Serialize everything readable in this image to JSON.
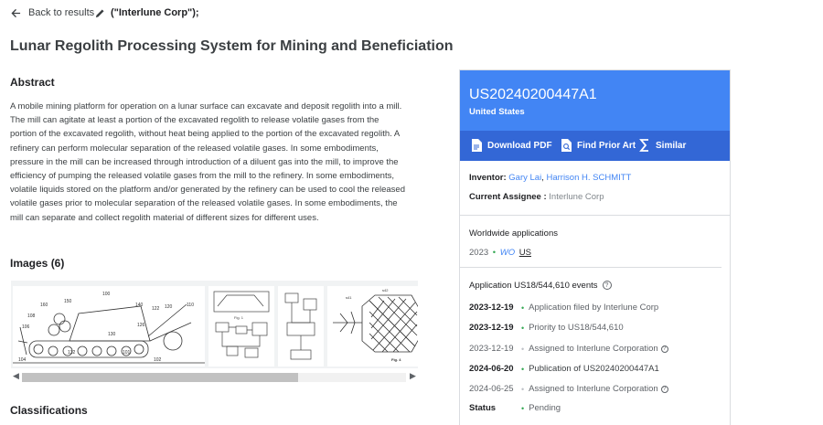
{
  "topbar": {
    "back_label": "Back to results",
    "query": "(\"Interlune Corp\");"
  },
  "title": "Lunar Regolith Processing System for Mining and Beneficiation",
  "abstract": {
    "heading": "Abstract",
    "text": "A mobile mining platform for operation on a lunar surface can excavate and deposit regolith into a mill. The mill can agitate at least a portion of the excavated regolith to release volatile gases from the portion of the excavated regolith, without heat being applied to the portion of the excavated regolith. A refinery can perform molecular separation of the released volatile gases. In some embodiments, pressure in the mill can be increased through introduction of a diluent gas into the mill, to improve the efficiency of pumping the released volatile gases from the mill to the refinery. In some embodiments, volatile liquids stored on the platform and/or generated by the refinery can be used to cool the released volatile gases prior to molecular separation of the released volatile gases. In some embodiments, the mill can separate and collect regolith material of different sizes for different uses."
  },
  "images": {
    "heading": "Images (6)",
    "fig1_labels": [
      "100",
      "160",
      "150",
      "140",
      "122",
      "120",
      "110",
      "108",
      "106",
      "130",
      "126",
      "132",
      "101",
      "102",
      "104"
    ],
    "fig_small_labels": [
      "Fig. 1",
      "Fig. 4",
      "s41",
      "s42"
    ]
  },
  "classifications": {
    "heading": "Classifications"
  },
  "card": {
    "pub_number": "US20240200447A1",
    "country": "United States",
    "actions": [
      "Download PDF",
      "Find Prior Art",
      "Similar"
    ],
    "inventor_label": "Inventor:",
    "inventors": [
      "Gary Lai",
      "Harrison H. SCHMITT"
    ],
    "assignee_label": "Current Assignee :",
    "assignee": "Interlune Corp",
    "worldwide_heading": "Worldwide applications",
    "worldwide_year": "2023",
    "worldwide_wo": "WO",
    "worldwide_us": "US",
    "events_heading": "Application US18/544,610 events",
    "events": [
      {
        "date": "2023-12-19",
        "desc": "Application filed by Interlune Corp"
      },
      {
        "date": "2023-12-19",
        "desc": "Priority to US18/544,610"
      },
      {
        "date": "2023-12-19",
        "desc": "Assigned to Interlune Corporation"
      },
      {
        "date": "2024-06-20",
        "desc": "Publication of US20240200447A1"
      },
      {
        "date": "2024-06-25",
        "desc": "Assigned to Interlune Corporation"
      },
      {
        "date": "Status",
        "desc": "Pending"
      }
    ]
  },
  "colors": {
    "header_blue": "#4285f4",
    "actions_blue": "#3367d6",
    "status_green": "#34a853"
  }
}
